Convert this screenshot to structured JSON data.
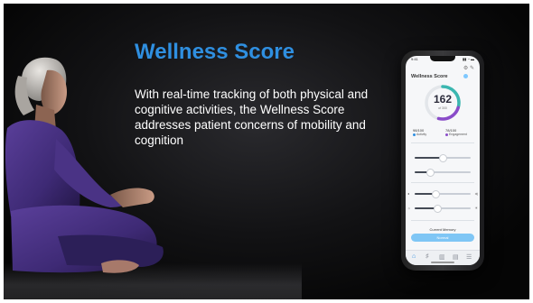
{
  "slide": {
    "title": "Wellness Score",
    "body": "With real-time tracking of both physical and cognitive activities, the Wellness Score addresses patient concerns of mobility and cognition"
  },
  "phone": {
    "status_time": "9:41",
    "status_icons": "▮▮ ◔ ▬",
    "top_icons": "⚙ ✎",
    "app_title": "Wellness Score",
    "score": "162",
    "score_sub": "of 300",
    "score_fraction": 0.54,
    "metric_left": {
      "value": "98/100",
      "label": "Activity",
      "color": "#2f8fe0"
    },
    "metric_right": {
      "value": "78/100",
      "label": "Engagement",
      "color": "#8a4cc9"
    },
    "memory_label": "Current Memory",
    "memory_button": "Normal",
    "nav_icons": [
      "⌂",
      "♯",
      "▥",
      "▤",
      "☰"
    ]
  },
  "colors": {
    "title_blue": "#2f8fe0",
    "gauge_teal": "#3bb7b0",
    "gauge_purple": "#8a4cc9",
    "memory_blue": "#7fc6f5"
  }
}
